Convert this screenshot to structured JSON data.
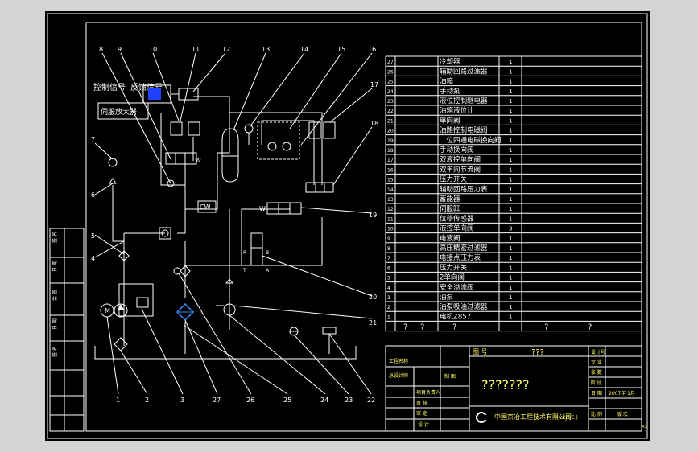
{
  "components": [
    {
      "no": "27",
      "name": "冷却器",
      "qty": "1"
    },
    {
      "no": "26",
      "name": "辅助回路过滤器",
      "qty": "1"
    },
    {
      "no": "25",
      "name": "油箱",
      "qty": "1"
    },
    {
      "no": "24",
      "name": "手动泵",
      "qty": "1"
    },
    {
      "no": "23",
      "name": "液位控制继电器",
      "qty": "1"
    },
    {
      "no": "22",
      "name": "油箱液位计",
      "qty": "1"
    },
    {
      "no": "21",
      "name": "单向阀",
      "qty": "1"
    },
    {
      "no": "20",
      "name": "油路控制电磁阀",
      "qty": "1"
    },
    {
      "no": "19",
      "name": "二位四通电磁换向阀",
      "qty": "1"
    },
    {
      "no": "18",
      "name": "手动换向阀",
      "qty": "1"
    },
    {
      "no": "17",
      "name": "双液控单向阀",
      "qty": "1"
    },
    {
      "no": "16",
      "name": "双单向节流阀",
      "qty": "1"
    },
    {
      "no": "15",
      "name": "压力开关",
      "qty": "1"
    },
    {
      "no": "14",
      "name": "辅助回路压力表",
      "qty": "1"
    },
    {
      "no": "13",
      "name": "蓄能器",
      "qty": "1"
    },
    {
      "no": "12",
      "name": "伺服缸",
      "qty": "1"
    },
    {
      "no": "11",
      "name": "位移传感器",
      "qty": "1"
    },
    {
      "no": "10",
      "name": "液控单向阀",
      "qty": "3"
    },
    {
      "no": "9",
      "name": "电液阀",
      "qty": "1"
    },
    {
      "no": "8",
      "name": "高压精密过滤器",
      "qty": "1"
    },
    {
      "no": "7",
      "name": "电接点压力表",
      "qty": "1"
    },
    {
      "no": "6",
      "name": "压力开关",
      "qty": "1"
    },
    {
      "no": "5",
      "name": "2单向阀",
      "qty": "1"
    },
    {
      "no": "4",
      "name": "安全溢流阀",
      "qty": "1"
    },
    {
      "no": "3",
      "name": "油泵",
      "qty": "1"
    },
    {
      "no": "2",
      "name": "油泵吸油过滤器",
      "qty": "1"
    },
    {
      "no": "1",
      "name": "电机Z857",
      "qty": "1"
    }
  ],
  "table_unknown": [
    "?",
    "?",
    "?",
    "?",
    "?"
  ],
  "diagram": {
    "labels_top": [
      "8",
      "9",
      "10",
      "11",
      "12",
      "13",
      "14",
      "15",
      "16"
    ],
    "labels_right": [
      "17",
      "18",
      "19",
      "20",
      "21"
    ],
    "labels_left": [
      "7",
      "6",
      "5",
      "4"
    ],
    "labels_bottom": [
      "1",
      "2",
      "3",
      "27",
      "26",
      "25",
      "24",
      "23",
      "22"
    ],
    "control_signal": "控制信号",
    "feedback_signal": "反馈信号",
    "servo_amp": "伺服放大器",
    "cw": "CW",
    "w": "W",
    "w2": "W",
    "p": "P",
    "t": "T",
    "a": "A",
    "b": "B"
  },
  "title_block": {
    "drawing_no_label": "图 号",
    "drawing_no": "???",
    "drawing_name": "???????",
    "company": "中国京冶工程技术有限公司",
    "company_code": "( CJ YC )",
    "date": "2007年 1月",
    "sheet_size": "A3",
    "left_labels": [
      "工程名称",
      "总设计师",
      "项目负责人",
      "审 核",
      "审 定",
      "设 计",
      "制 图"
    ],
    "right_labels": [
      "设计号",
      "专 业",
      "张 数",
      "阶 段",
      "日 期",
      "比 例",
      "版 次"
    ],
    "side_labels": [
      "签 名",
      "日 期",
      "会 签",
      "日 期",
      "签 名"
    ]
  }
}
